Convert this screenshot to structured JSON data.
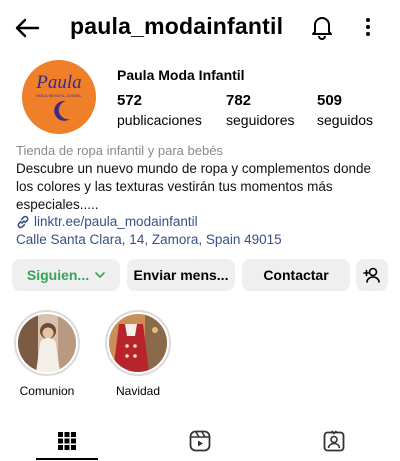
{
  "header": {
    "username": "paula_modainfantil",
    "back_icon": "arrow-left-icon",
    "notifications_icon": "bell-icon",
    "more_icon": "more-vertical-icon"
  },
  "profile": {
    "avatar": {
      "brand_text": "Paula",
      "tagline": "MODA INFANTIL JUVENIL",
      "colors": {
        "background": "#f07f2a",
        "ink": "#3b2b86"
      }
    },
    "display_name": "Paula Moda Infantil",
    "stats": [
      {
        "value": "572",
        "label": "publicaciones"
      },
      {
        "value": "782",
        "label": "seguidores"
      },
      {
        "value": "509",
        "label": "seguidos"
      }
    ],
    "category": "Tienda de ropa infantil y para bebés",
    "bio": "Descubre un nuevo mundo de ropa y complementos donde los colores y las texturas vestirán tus momentos más especiales.....",
    "link": "linktr.ee/paula_modainfantil",
    "address": "Calle Santa Clara, 14, Zamora, Spain 49015"
  },
  "actions": {
    "following_label": "Siguien...",
    "message_label": "Enviar mens...",
    "contact_label": "Contactar",
    "add_user_icon": "add-user-icon",
    "colors": {
      "following": "#36a35a",
      "button_bg": "#efefef",
      "link": "#385185"
    }
  },
  "highlights": [
    {
      "label": "Comunion"
    },
    {
      "label": "Navidad"
    }
  ],
  "tabs": [
    {
      "icon": "grid-icon",
      "selected": true
    },
    {
      "icon": "reels-icon",
      "selected": false
    },
    {
      "icon": "tagged-icon",
      "selected": false
    }
  ]
}
